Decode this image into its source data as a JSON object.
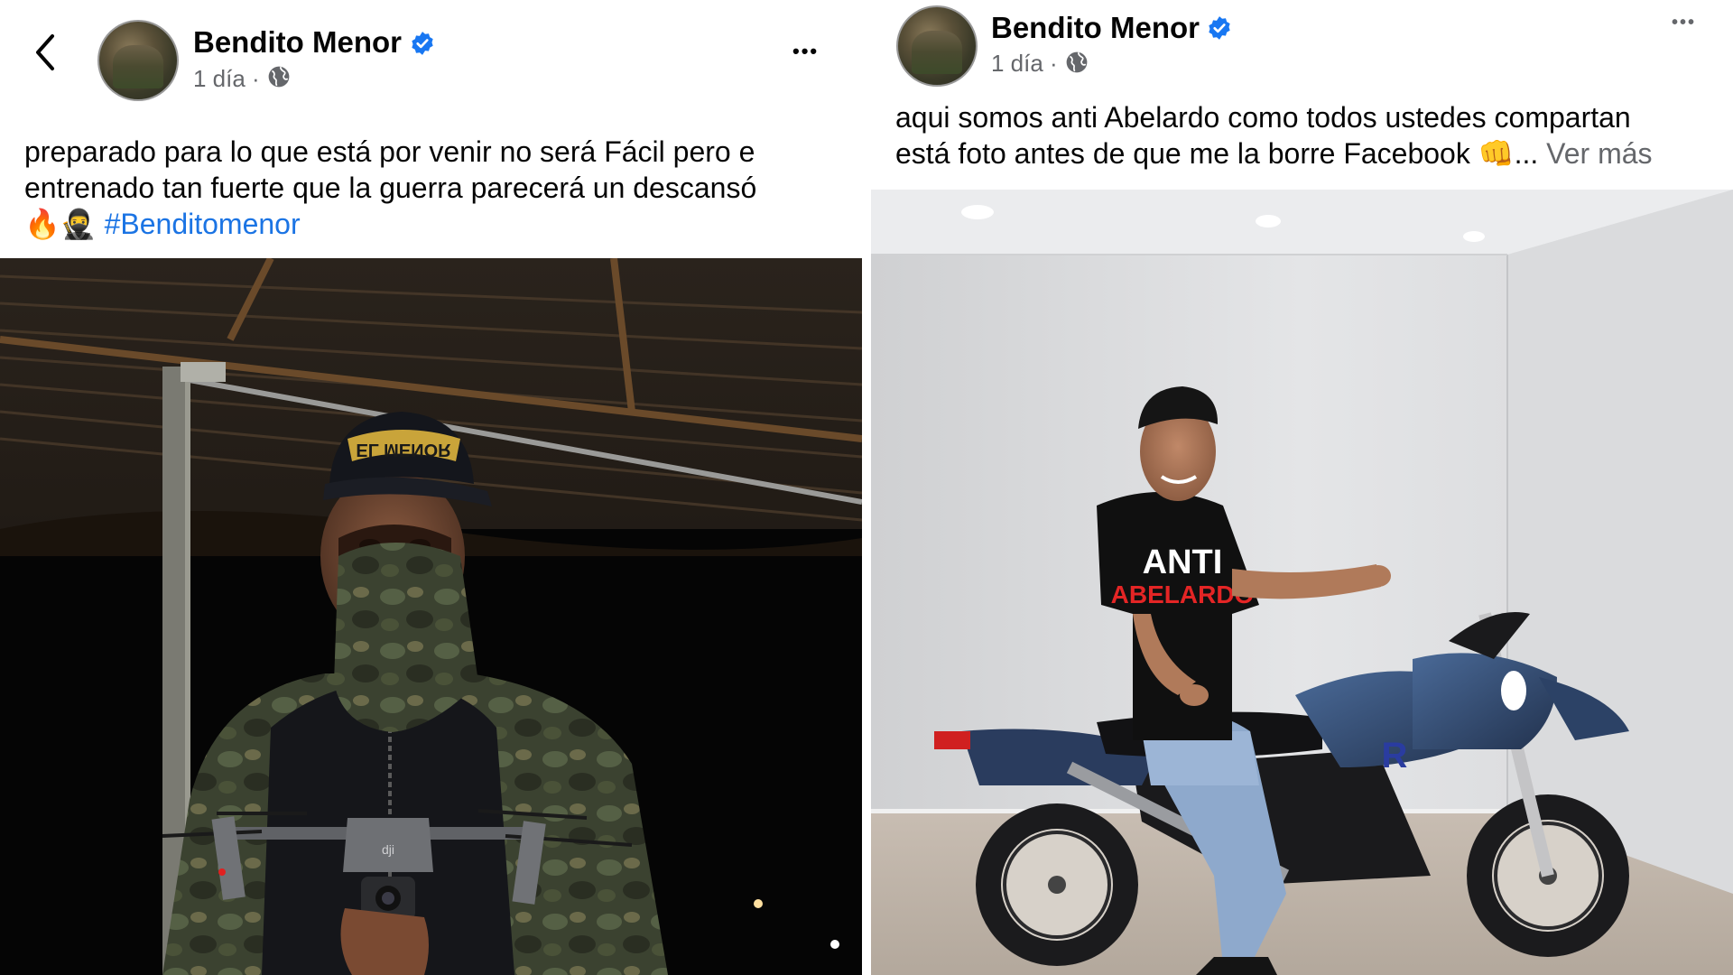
{
  "left_post": {
    "author": "Bendito Menor",
    "time": "1 día",
    "separator": "·",
    "caption_line1": "preparado para lo que está por venir no será Fácil pero e",
    "caption_line2": "entrenado tan fuerte que la guerra parecerá un descansó",
    "caption_emojis": "🔥🥷",
    "hashtag": "#Benditomenor",
    "more_label": "•••",
    "photo": {
      "cap_text": "EL MENOR",
      "drone_brand": "dji"
    }
  },
  "right_post": {
    "author": "Bendito Menor",
    "time": "1 día",
    "separator": "·",
    "caption_line1": "aqui somos anti Abelardo como todos ustedes compartan",
    "caption_line2": "está foto antes de que me la borre Facebook",
    "caption_emoji": "👊",
    "ellipsis": "...",
    "see_more": "Ver más",
    "more_label": "•••",
    "photo": {
      "shirt_line1": "ANTI",
      "shirt_line2": "ABELARDO",
      "bike_text": "R"
    }
  },
  "colors": {
    "verified_blue": "#1877f2",
    "hashtag_blue": "#1b74e4",
    "meta_gray": "#65676b"
  },
  "icons": [
    "back-chevron-icon",
    "verified-badge-icon",
    "globe-icon",
    "more-options-icon"
  ]
}
